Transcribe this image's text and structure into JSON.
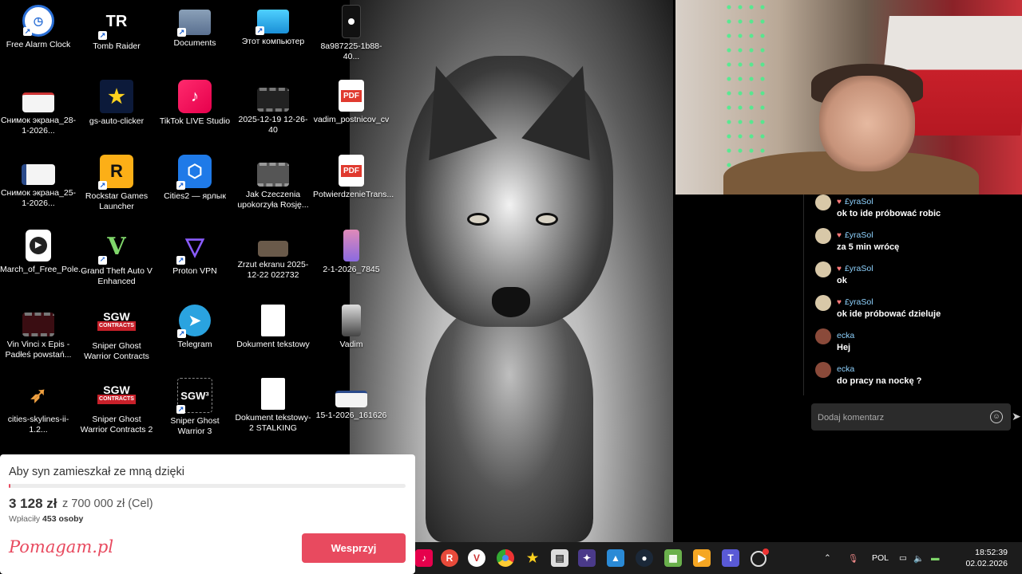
{
  "desktop": {
    "icons": [
      {
        "label": "Free Alarm Clock",
        "icon": "alarm-clock-icon"
      },
      {
        "label": "Tomb Raider",
        "icon": "tomb-raider-icon"
      },
      {
        "label": "Documents",
        "icon": "folder-icon"
      },
      {
        "label": "Этот компьютер",
        "icon": "monitor-icon"
      },
      {
        "label": "8a987225-1b88-40...",
        "icon": "image-file-icon"
      },
      {
        "label": "Снимок экрана_28-1-2026...",
        "icon": "screenshot-icon"
      },
      {
        "label": "gs-auto-clicker",
        "icon": "star-icon"
      },
      {
        "label": "TikTok LIVE Studio",
        "icon": "tiktok-icon"
      },
      {
        "label": "2025-12-19 12-26-40",
        "icon": "video-file-icon"
      },
      {
        "label": "vadim_postnicov_cv",
        "icon": "pdf-icon"
      },
      {
        "label": "Снимок экрана_25-1-2026...",
        "icon": "screenshot-icon"
      },
      {
        "label": "Rockstar Games Launcher",
        "icon": "rockstar-icon"
      },
      {
        "label": "Cities2 — ярлык",
        "icon": "cities2-icon"
      },
      {
        "label": "Jak Czeczenia upokorzyła Rosję...",
        "icon": "video-file-icon"
      },
      {
        "label": "PotwierdzenieTrans...",
        "icon": "pdf-icon"
      },
      {
        "label": "March_of_Free_Pole...",
        "icon": "media-file-icon"
      },
      {
        "label": "Grand Theft Auto V Enhanced",
        "icon": "gta-v-icon"
      },
      {
        "label": "Proton VPN",
        "icon": "proton-vpn-icon"
      },
      {
        "label": "Zrzut ekranu 2025-12-22 022732",
        "icon": "screenshot-icon"
      },
      {
        "label": "2-1-2026_7845",
        "icon": "image-file-icon"
      },
      {
        "label": "Vin Vinci x Epis - Padłeś powstań...",
        "icon": "video-file-icon"
      },
      {
        "label": "Sniper Ghost Warrior Contracts",
        "icon": "sgw-contracts-icon"
      },
      {
        "label": "Telegram",
        "icon": "telegram-icon"
      },
      {
        "label": "Dokument tekstowy",
        "icon": "text-file-icon"
      },
      {
        "label": "Vadim",
        "icon": "image-file-icon"
      },
      {
        "label": "cities-skylines-ii-1.2...",
        "icon": "rocket-icon"
      },
      {
        "label": "Sniper Ghost Warrior Contracts 2",
        "icon": "sgw-contracts2-icon"
      },
      {
        "label": "Sniper Ghost Warrior 3",
        "icon": "sgw3-icon"
      },
      {
        "label": "Dokument tekstowy-2 STALKING",
        "icon": "text-file-icon"
      },
      {
        "label": "15-1-2026_161626",
        "icon": "screenshot-icon"
      }
    ],
    "icon_glyphs": {
      "tomb": "TR",
      "pdf": "PDF",
      "rockstar": "R",
      "sgw": "SGW",
      "sgw_sub": "CONTRACTS",
      "sgw3": "SGW³"
    }
  },
  "chat": {
    "messages": [
      {
        "user": "£yraSol",
        "text": "ok to ide próbować robic"
      },
      {
        "user": "£yraSol",
        "text": "za 5 min wrócę"
      },
      {
        "user": "£yraSol",
        "text": "ok"
      },
      {
        "user": "£yraSol",
        "text": "ok ide próbować dzieluje"
      },
      {
        "user": "ecka",
        "text": "Hej"
      },
      {
        "user": "ecka",
        "text": "do pracy na nockę ?"
      }
    ],
    "comment_placeholder": "Dodaj komentarz"
  },
  "fundraiser": {
    "title": "Aby syn zamieszkał ze mną dzięki",
    "amount": "3 128 zł",
    "goal": "z 700 000 zł (Cel)",
    "payers_label": "Wpłaciły",
    "payers_count": "453 osoby",
    "progress_fraction": 0.0045,
    "logo": "Pomagam.pl",
    "button_label": "Wesprzyj",
    "accent_color": "#e84a5f"
  },
  "taskbar": {
    "language": "POL",
    "time": "18:52:39",
    "date": "02.02.2026"
  }
}
